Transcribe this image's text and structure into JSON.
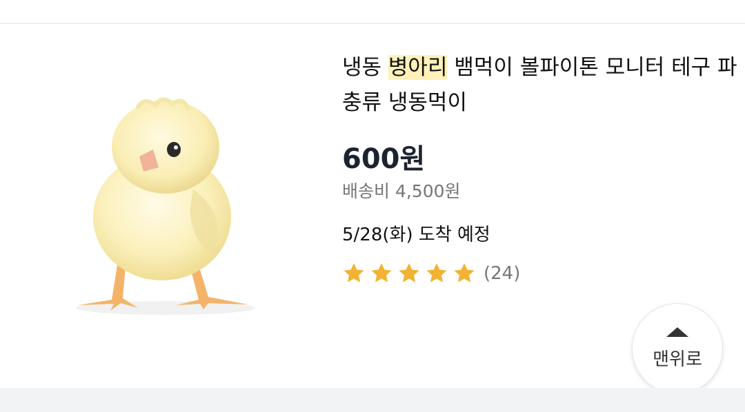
{
  "product": {
    "title_prefix": "냉동 ",
    "title_highlight": "병아리",
    "title_suffix": " 뱀먹이 볼파이톤 모니터 테구 파충류 냉동먹이",
    "price": "600원",
    "shipping": "배송비 4,500원",
    "delivery": "5/28(화) 도착 예정",
    "rating": 5,
    "review_count": "(24)",
    "image_icon": "chick-photo"
  },
  "back_to_top": {
    "label": "맨위로",
    "icon": "arrow-up-icon"
  },
  "colors": {
    "star": "#f2b233",
    "highlight": "#fff1b8",
    "price": "#1c2330",
    "muted": "#757575"
  }
}
